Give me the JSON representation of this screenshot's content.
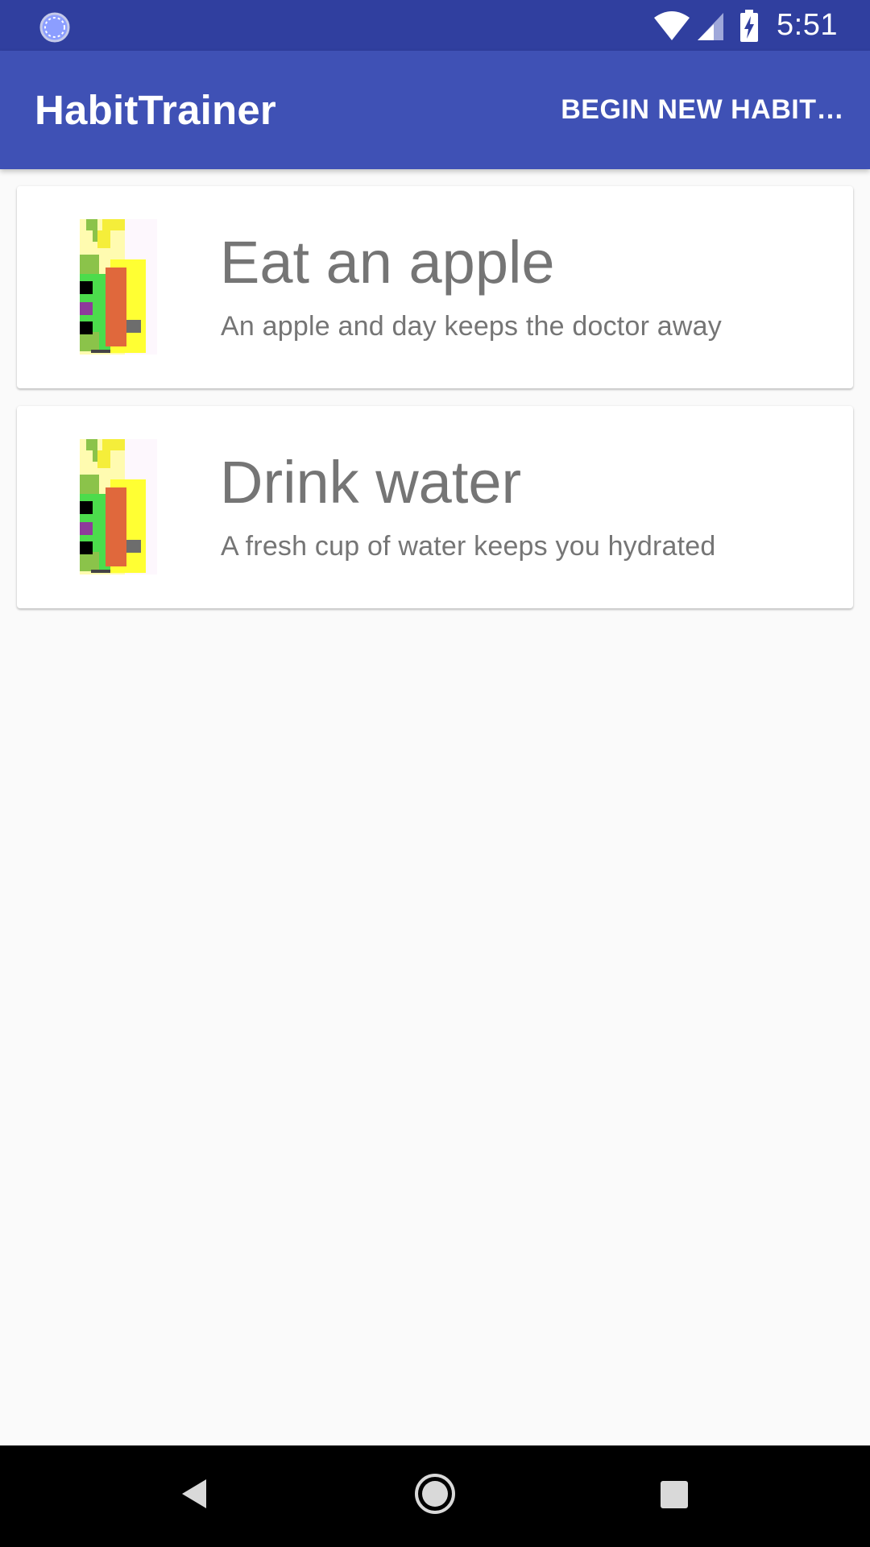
{
  "status_bar": {
    "time": "5:51",
    "icons": [
      "loading-icon",
      "wifi-icon",
      "cell-signal-icon",
      "battery-charging-icon"
    ]
  },
  "app_bar": {
    "title": "HabitTrainer",
    "action_label": "BEGIN NEW HABIT…"
  },
  "habits": [
    {
      "title": "Eat an apple",
      "description": "An apple and day keeps the doctor away"
    },
    {
      "title": "Drink water",
      "description": "A fresh cup of water keeps you hydrated"
    }
  ],
  "nav_bar": {
    "icons": [
      "back-icon",
      "home-icon",
      "recents-icon"
    ]
  },
  "colors": {
    "status_bar": "#303f9f",
    "app_bar": "#3f51b5",
    "background": "#fafafa",
    "text_secondary": "#757575"
  }
}
